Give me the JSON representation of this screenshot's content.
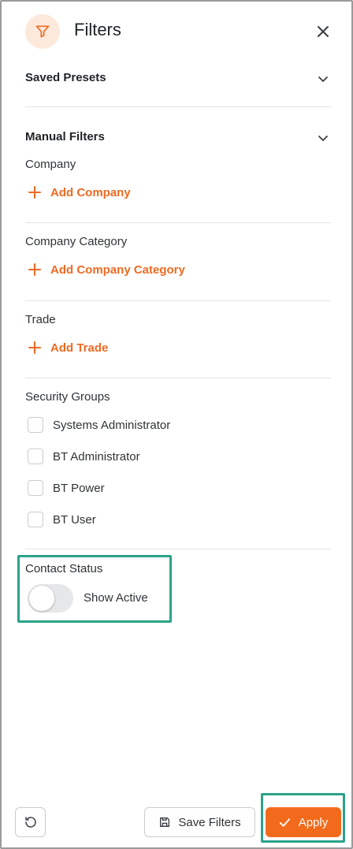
{
  "header": {
    "title": "Filters",
    "filter_icon": "funnel-icon",
    "close_icon": "close-icon"
  },
  "saved_presets": {
    "label": "Saved Presets"
  },
  "manual_filters": {
    "label": "Manual Filters"
  },
  "company": {
    "label": "Company",
    "add_label": "Add Company"
  },
  "company_category": {
    "label": "Company Category",
    "add_label": "Add Company Category"
  },
  "trade": {
    "label": "Trade",
    "add_label": "Add Trade"
  },
  "security_groups": {
    "label": "Security Groups",
    "items": [
      {
        "label": "Systems Administrator",
        "checked": false
      },
      {
        "label": "BT Administrator",
        "checked": false
      },
      {
        "label": "BT Power",
        "checked": false
      },
      {
        "label": "BT User",
        "checked": false
      }
    ]
  },
  "contact_status": {
    "label": "Contact Status",
    "toggle_label": "Show Active",
    "on": false
  },
  "footer": {
    "save_label": "Save Filters",
    "apply_label": "Apply"
  },
  "colors": {
    "accent": "#f26a1b",
    "accent_light": "#fde9dc",
    "highlight": "#2aa389",
    "border": "#c9ccd1"
  }
}
